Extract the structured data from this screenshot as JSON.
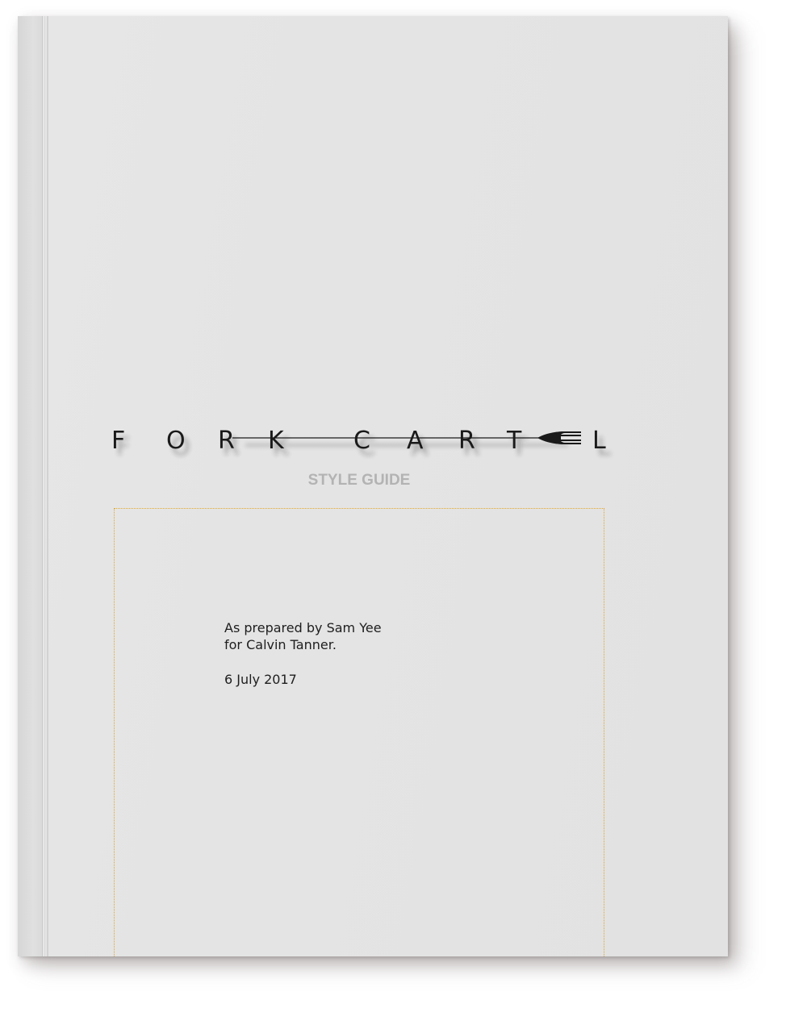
{
  "cover": {
    "brand": "FORK CARTEL",
    "brand_letters": [
      "F",
      "O",
      "R",
      "K",
      "C",
      "A",
      "R",
      "T",
      "L"
    ],
    "subtitle": "STYLE GUIDE",
    "prepared_by": "As prepared by Sam Yee",
    "prepared_for": "for Calvin Tanner.",
    "date": "6 July 2017"
  },
  "colors": {
    "cover": "#e4e4e4",
    "text": "#1a1a1a",
    "subtitle": "#b3b3b3",
    "frame": "#e0a830"
  },
  "icons": {
    "logo_mark": "fork-icon"
  }
}
